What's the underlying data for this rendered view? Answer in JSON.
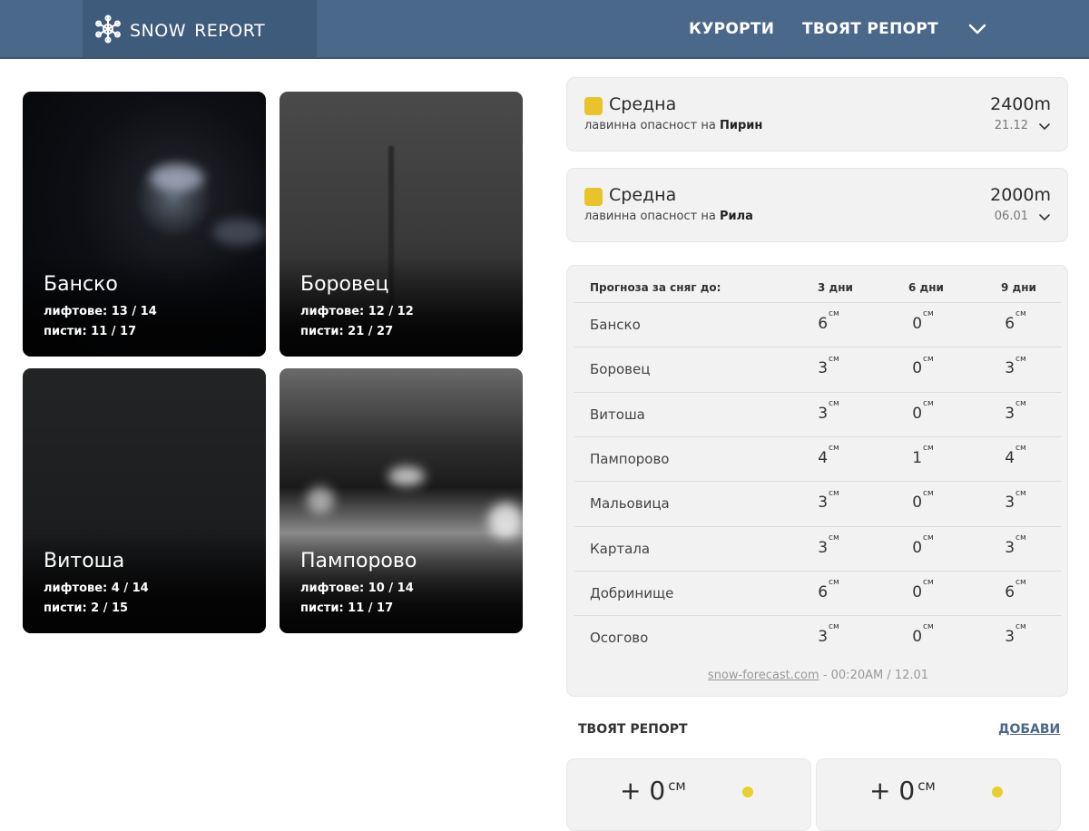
{
  "header": {
    "logo_text": "snow report",
    "nav_resorts": "КУРОРТИ",
    "nav_report": "ТВОЯТ РЕПОРТ",
    "bg_color": "#4a6889"
  },
  "webcams": [
    {
      "name": "Банско",
      "lifts": "лифтове: 13 / 14",
      "pistes": "писти: 11 / 17"
    },
    {
      "name": "Боровец",
      "lifts": "лифтове: 12 / 12",
      "pistes": "писти: 21 / 27"
    },
    {
      "name": "Витоша",
      "lifts": "лифтове: 4 / 14",
      "pistes": "писти: 2 / 15"
    },
    {
      "name": "Пампорово",
      "lifts": "лифтове: 10 / 14",
      "pistes": "писти: 11 / 17"
    }
  ],
  "avalanche": [
    {
      "level": "Средна",
      "label": "лавинна опасност на ",
      "region": "Пирин",
      "altitude": "2400m",
      "date": "21.12",
      "level_color": "#e8c42a"
    },
    {
      "level": "Средна",
      "label": "лавинна опасност на ",
      "region": "Рила",
      "altitude": "2000m",
      "date": "06.01",
      "level_color": "#e8c42a"
    }
  ],
  "forecast": {
    "header_label": "Прогноза за сняг до:",
    "col_3": "3 дни",
    "col_6": "6 дни",
    "col_9": "9 дни",
    "unit": "см",
    "rows": [
      {
        "name": "Банско",
        "d3": "6",
        "d6": "0",
        "d9": "6"
      },
      {
        "name": "Боровец",
        "d3": "3",
        "d6": "0",
        "d9": "3"
      },
      {
        "name": "Витоша",
        "d3": "3",
        "d6": "0",
        "d9": "3"
      },
      {
        "name": "Пампорово",
        "d3": "4",
        "d6": "1",
        "d9": "4"
      },
      {
        "name": "Мальовица",
        "d3": "3",
        "d6": "0",
        "d9": "3"
      },
      {
        "name": "Картала",
        "d3": "3",
        "d6": "0",
        "d9": "3"
      },
      {
        "name": "Добринище",
        "d3": "6",
        "d6": "0",
        "d9": "6"
      },
      {
        "name": "Осогово",
        "d3": "3",
        "d6": "0",
        "d9": "3"
      }
    ],
    "source_link": "snow-forecast.com",
    "source_time": " - 00:20AM / 12.01"
  },
  "your_report": {
    "title": "ТВОЯТ РЕПОРТ",
    "add_label": "ДОБАВИ",
    "cards": [
      {
        "value": "+ 0",
        "unit": "см",
        "dot_color": "#e8cf2a"
      },
      {
        "value": "+ 0",
        "unit": "см",
        "dot_color": "#e8cf2a"
      }
    ]
  }
}
